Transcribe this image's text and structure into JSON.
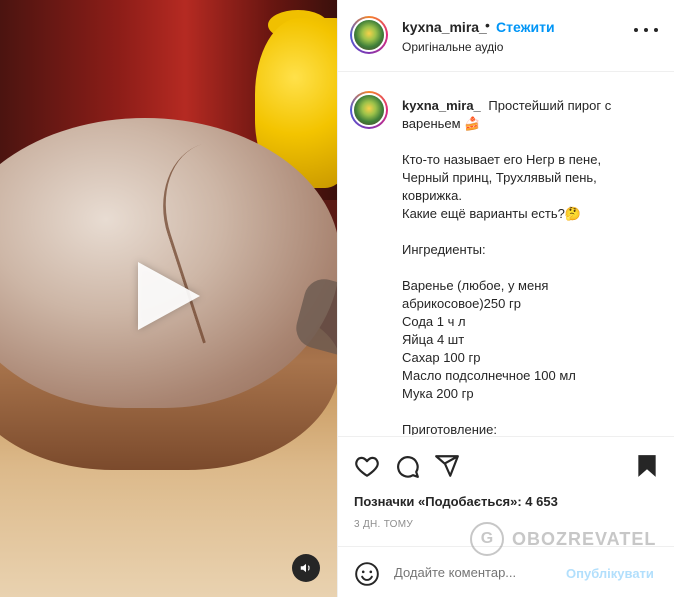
{
  "post": {
    "username": "kyxna_mira_",
    "dot": "•",
    "follow_label": "Стежити",
    "audio_label": "Оригінальне аудіо"
  },
  "caption": {
    "username": "kyxna_mira_",
    "title": "Простейший пирог с вареньем 🍰",
    "lines": [
      "Кто-то называет его Негр в пене,",
      "Черный принц, Трухлявый пень,",
      "коврижка.",
      "Какие ещё варианты есть?🤔",
      "",
      "Ингредиенты:",
      "",
      "Варенье (любое, у меня",
      "абрикосовое)250 гр",
      "Сода 1 ч л",
      "Яйца 4 шт",
      "Сахар 100 гр",
      "Масло подсолнечное 100 мл",
      "Мука 200 гр",
      "",
      "Приготовление:"
    ]
  },
  "actions": {
    "like_icon": "heart-icon",
    "comment_icon": "comment-icon",
    "share_icon": "share-icon",
    "save_icon": "bookmark-icon"
  },
  "likes_text": "Позначки «Подобається»: 4 653",
  "time_text": "3 ДН. ТОМУ",
  "comment": {
    "placeholder": "Додайте коментар...",
    "publish_label": "Опублікувати"
  },
  "watermark": {
    "text": "OBOZREVATEL"
  },
  "colors": {
    "accent": "#0095f6",
    "publish_disabled": "#b2dffc",
    "muted": "#8e8e8e"
  }
}
